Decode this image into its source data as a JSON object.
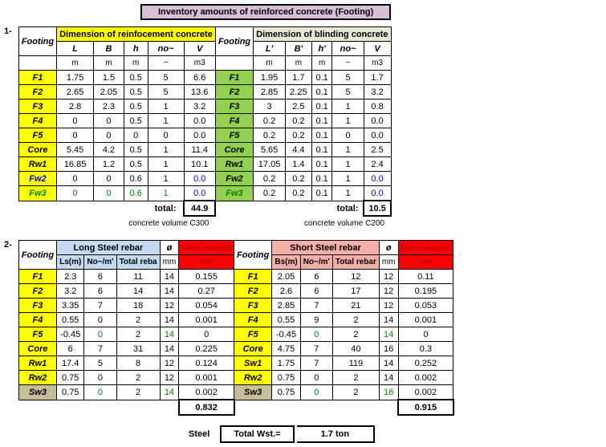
{
  "title": "Inventory amounts of reinforced concrete (Footing)",
  "sec1": {
    "num": "1-",
    "left_title": "Dimension of reinfocement concrete",
    "right_title": "Dimension of  blinding concrete",
    "footing": "Footing",
    "cols_left": [
      "L",
      "B",
      "h",
      "no~",
      "V"
    ],
    "units_left": [
      "m",
      "m",
      "m",
      "~",
      "m3"
    ],
    "cols_right": [
      "L'",
      "B'",
      "h'",
      "no~",
      "V"
    ],
    "units_right": [
      "m",
      "m",
      "m",
      "~",
      "m3"
    ],
    "rows": [
      {
        "n": "F1",
        "l": [
          "1.75",
          "1.5",
          "0.5",
          "5",
          "6.6"
        ],
        "r": [
          "1.95",
          "1.7",
          "0.1",
          "5",
          "1.7"
        ]
      },
      {
        "n": "F2",
        "l": [
          "2.65",
          "2.05",
          "0.5",
          "5",
          "13.6"
        ],
        "r": [
          "2.85",
          "2.25",
          "0.1",
          "5",
          "3.2"
        ]
      },
      {
        "n": "F3",
        "l": [
          "2.8",
          "2.3",
          "0.5",
          "1",
          "3.2"
        ],
        "r": [
          "3",
          "2.5",
          "0.1",
          "1",
          "0.8"
        ]
      },
      {
        "n": "F4",
        "l": [
          "0",
          "0",
          "0.5",
          "1",
          "0.0"
        ],
        "r": [
          "0.2",
          "0.2",
          "0.1",
          "1",
          "0.0"
        ]
      },
      {
        "n": "F5",
        "l": [
          "0",
          "0",
          "0",
          "0",
          "0.0"
        ],
        "r": [
          "0.2",
          "0.2",
          "0.1",
          "0",
          "0.0"
        ]
      },
      {
        "n": "Core",
        "l": [
          "5.45",
          "4.2",
          "0.5",
          "1",
          "11.4"
        ],
        "r": [
          "5.65",
          "4.4",
          "0.1",
          "1",
          "2.5"
        ]
      },
      {
        "n": "Rw1",
        "l": [
          "16.85",
          "1.2",
          "0.5",
          "1",
          "10.1"
        ],
        "r": [
          "17.05",
          "1.4",
          "0.1",
          "1",
          "2.4"
        ]
      },
      {
        "n": "Fw2",
        "l": [
          "0",
          "0",
          "0.6",
          "1",
          "0.0"
        ],
        "r": [
          "0.2",
          "0.2",
          "0.1",
          "1",
          "0.0"
        ],
        "blue": true
      },
      {
        "n": "Fw3",
        "l": [
          "0",
          "0",
          "0.6",
          "1",
          "0.0"
        ],
        "r": [
          "0.2",
          "0.2",
          "0.1",
          "1",
          "0.0"
        ],
        "green": true,
        "blue": true
      }
    ],
    "total_lbl": "total:",
    "total_left": "44.9",
    "total_right": "10.5",
    "note_left": "concrete volume C300",
    "note_right": "concrete volume C200"
  },
  "sec2": {
    "num": "2-",
    "footing": "Footing",
    "left_title": "Long Steel rebar",
    "dia": "ø",
    "own": "Own weight",
    "right_title": "Short Steel rebar",
    "subL": [
      "Ls(m)",
      "No~/m'",
      "Total reba"
    ],
    "mm": "mm",
    "ton": "ton",
    "subR": [
      "Bs(m)",
      "No~/m'",
      "Total rebar"
    ],
    "rows": [
      {
        "n": "F1",
        "l": [
          "2.3",
          "6",
          "11",
          "14",
          "0.155"
        ],
        "r": [
          "2.05",
          "6",
          "12",
          "12",
          "0.11"
        ]
      },
      {
        "n": "F2",
        "l": [
          "3.2",
          "6",
          "14",
          "14",
          "0.27"
        ],
        "r": [
          "2.6",
          "6",
          "17",
          "12",
          "0.195"
        ]
      },
      {
        "n": "F3",
        "l": [
          "3.35",
          "7",
          "18",
          "12",
          "0.054"
        ],
        "r": [
          "2.85",
          "7",
          "21",
          "12",
          "0.053"
        ]
      },
      {
        "n": "F4",
        "l": [
          "0.55",
          "0",
          "2",
          "14",
          "0.001"
        ],
        "r": [
          "0.55",
          "9",
          "2",
          "14",
          "0.001"
        ]
      },
      {
        "n": "F5",
        "l": [
          "-0.45",
          "0",
          "2",
          "14",
          "0"
        ],
        "r": [
          "-0.45",
          "0",
          "2",
          "14",
          "0"
        ],
        "g": [
          1,
          3
        ]
      },
      {
        "n": "Core",
        "l": [
          "6",
          "7",
          "31",
          "14",
          "0.225"
        ],
        "r": [
          "4.75",
          "7",
          "40",
          "16",
          "0.3"
        ]
      },
      {
        "n": "Rw1",
        "l": [
          "17.4",
          "5",
          "8",
          "12",
          "0.124"
        ],
        "rn": "Sw1",
        "r": [
          "1.75",
          "7",
          "119",
          "14",
          "0.252"
        ]
      },
      {
        "n": "Rw2",
        "l": [
          "0.75",
          "0",
          "2",
          "12",
          "0.001"
        ],
        "r": [
          "0.75",
          "0",
          "2",
          "14",
          "0.002"
        ]
      },
      {
        "n": "Sw3",
        "l": [
          "0.75",
          "0",
          "2",
          "14",
          "0.002"
        ],
        "r": [
          "0.75",
          "0",
          "2",
          "16",
          "0.002"
        ],
        "g": [
          1,
          3
        ],
        "olive": true
      }
    ],
    "sum_left": "0.832",
    "sum_right": "0.915",
    "steel": "Steel",
    "totw": "Total Wst.=",
    "ton_val": "1.7  ton"
  }
}
